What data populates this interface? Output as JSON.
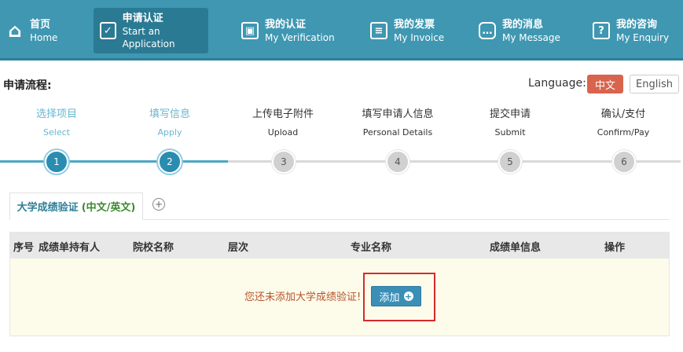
{
  "nav": [
    {
      "cn": "首页",
      "en": "Home",
      "icon": "house-icon",
      "glyph": "⌂"
    },
    {
      "cn": "申请认证",
      "en": "Start an Application",
      "icon": "checkbox-icon",
      "glyph": "✓"
    },
    {
      "cn": "我的认证",
      "en": "My Verification",
      "icon": "certificate-icon",
      "glyph": "▣"
    },
    {
      "cn": "我的发票",
      "en": "My Invoice",
      "icon": "invoice-icon",
      "glyph": "≡"
    },
    {
      "cn": "我的消息",
      "en": "My Message",
      "icon": "message-icon",
      "glyph": "…"
    },
    {
      "cn": "我的咨询",
      "en": "My Enquiry",
      "icon": "question-icon",
      "glyph": "?"
    }
  ],
  "active_nav_index": 1,
  "flow_title": "申请流程:",
  "language": {
    "label": "Language:",
    "cn": "中文",
    "en": "English",
    "selected": "中文"
  },
  "steps": [
    {
      "cn": "选择项目",
      "en": "Select",
      "num": "1",
      "done": true
    },
    {
      "cn": "填写信息",
      "en": "Apply",
      "num": "2",
      "done": true
    },
    {
      "cn": "上传电子附件",
      "en": "Upload",
      "num": "3",
      "done": false
    },
    {
      "cn": "填写申请人信息",
      "en": "Personal Details",
      "num": "4",
      "done": false
    },
    {
      "cn": "提交申请",
      "en": "Submit",
      "num": "5",
      "done": false
    },
    {
      "cn": "确认/支付",
      "en": "Confirm/Pay",
      "num": "6",
      "done": false
    }
  ],
  "tab": {
    "label": "大学成绩验证",
    "sub": "(中文/英文)",
    "add_glyph": "+"
  },
  "table": {
    "headers": [
      "序号",
      "成绩单持有人",
      "院校名称",
      "层次",
      "专业名称",
      "成绩单信息",
      "操作"
    ],
    "empty_message": "您还未添加大学成绩验证!",
    "add_button": "添加",
    "add_glyph": "+"
  },
  "colors": {
    "nav_bg": "#3f97b2",
    "accent": "#2a8cb1",
    "lang_selected": "#d9644d",
    "empty_text": "#b5552e",
    "highlight": "#d62a2a"
  }
}
